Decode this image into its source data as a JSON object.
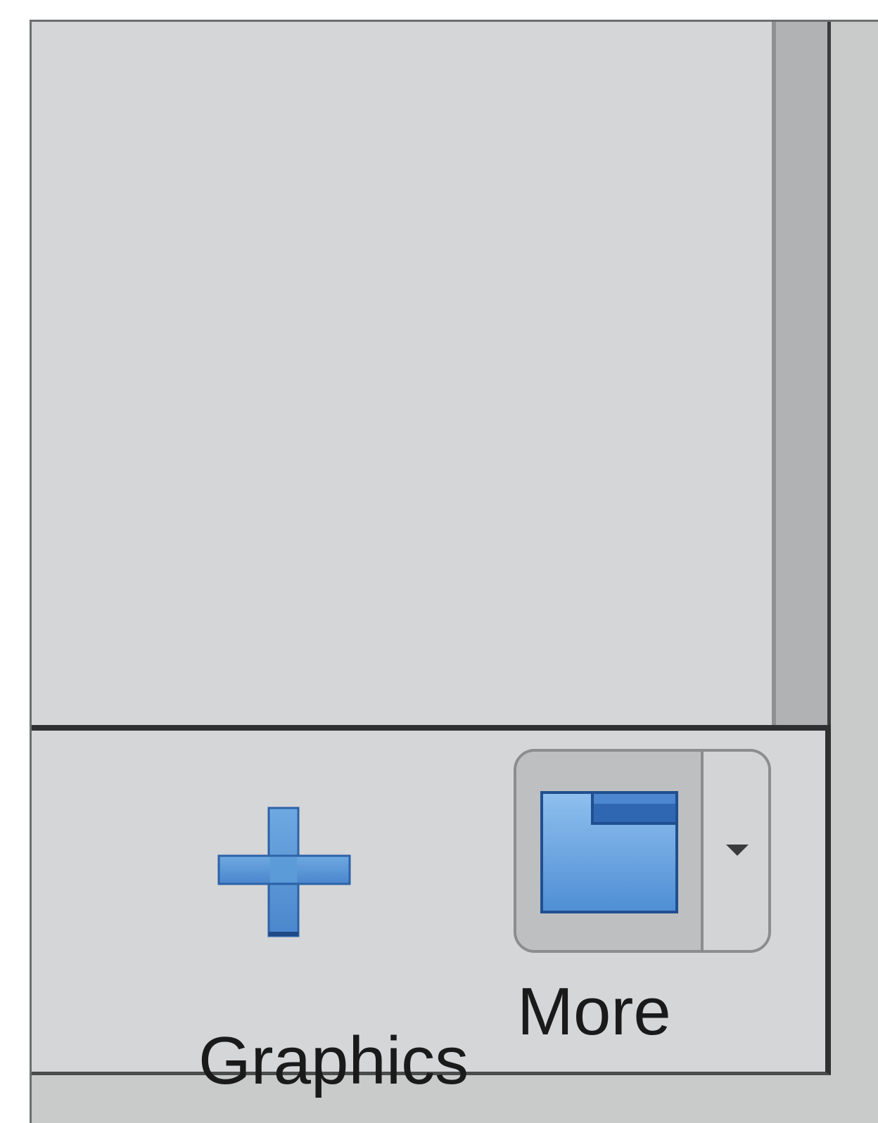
{
  "toolbar": {
    "items": [
      {
        "label": "Graphics",
        "icon": "plus-icon"
      },
      {
        "label": "More",
        "icon": "folder-icon",
        "dropdown_icon": "chevron-down-icon"
      }
    ]
  },
  "colors": {
    "icon_blue": "#5b9bd8",
    "icon_blue_dark": "#2d62a8",
    "pane_background": "#d4d6d7",
    "scrollbar_track": "#b0b2b4"
  }
}
